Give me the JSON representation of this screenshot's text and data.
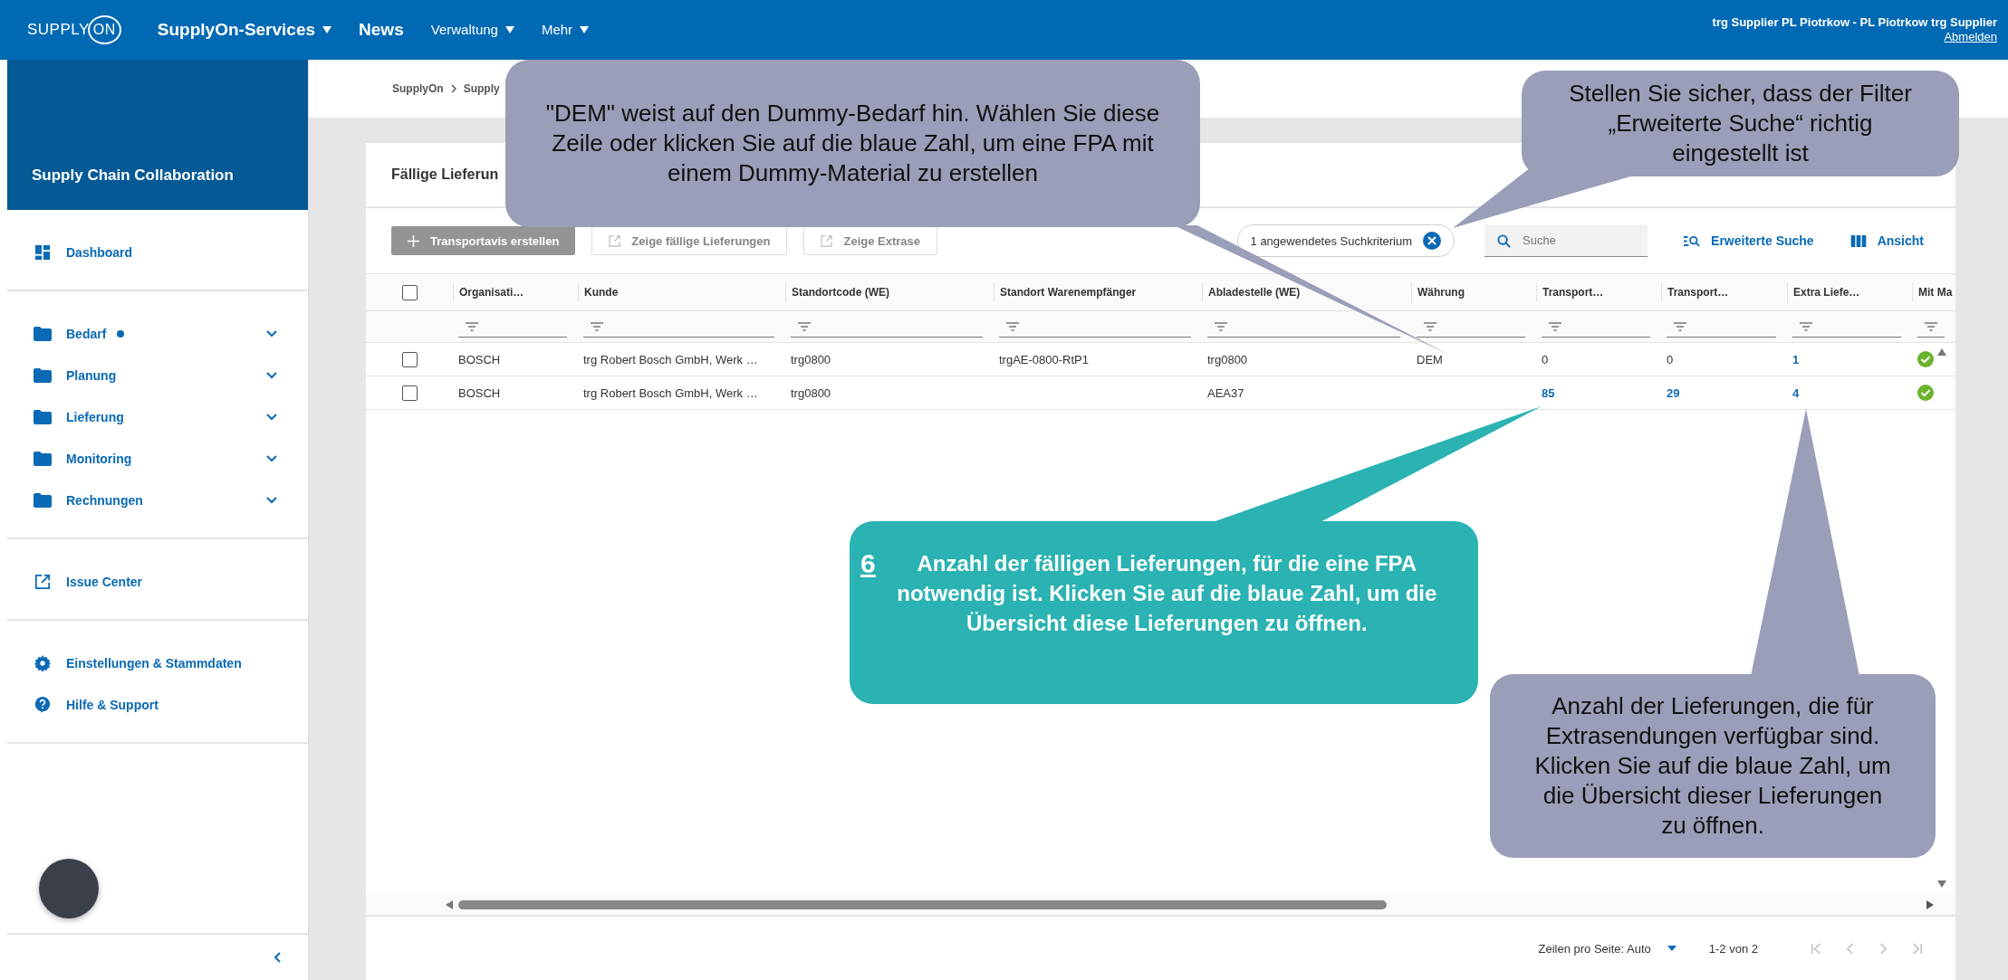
{
  "top_bar": {
    "logo_text": "SUPPLY",
    "logo_mark": "ON",
    "menu": [
      {
        "label": "SupplyOn-Services",
        "kind": "main",
        "dropdown": true
      },
      {
        "label": "News",
        "kind": "main",
        "dropdown": false
      },
      {
        "label": "Verwaltung",
        "kind": "sub",
        "dropdown": true
      },
      {
        "label": "Mehr",
        "kind": "sub",
        "dropdown": true
      }
    ],
    "user": "trg Supplier PL Piotrkow - PL Piotrkow trg Supplier",
    "logout": "Abmelden"
  },
  "sidebar": {
    "header": "Supply Chain Collaboration",
    "groups": [
      [
        {
          "label": "Dashboard",
          "kind": "dashboard"
        }
      ],
      [
        {
          "label": "Bedarf",
          "kind": "folder",
          "expanded": false,
          "notification": true
        },
        {
          "label": "Planung",
          "kind": "folder",
          "expanded": false,
          "notification": false
        },
        {
          "label": "Lieferung",
          "kind": "folder",
          "expanded": false,
          "notification": false
        },
        {
          "label": "Monitoring",
          "kind": "folder",
          "expanded": false,
          "notification": false
        },
        {
          "label": "Rechnungen",
          "kind": "folder",
          "expanded": false,
          "notification": false
        }
      ],
      [
        {
          "label": "Issue Center",
          "kind": "external"
        }
      ],
      [
        {
          "label": "Einstellungen & Stammdaten",
          "kind": "settings"
        },
        {
          "label": "Hilfe & Support",
          "kind": "help"
        }
      ]
    ]
  },
  "breadcrumb": [
    "SupplyOn",
    "Supply"
  ],
  "card": {
    "title": "Fällige Lieferun",
    "toolbar": {
      "buttons": [
        {
          "label": "Transportavis erstellen",
          "kind": "primary",
          "disabled": true
        },
        {
          "label": "Zeige fällige Lieferungen",
          "kind": "outline",
          "disabled": true
        },
        {
          "label": "Zeige Extrase",
          "kind": "outline",
          "disabled": true
        }
      ],
      "chip": "1 angewendetes Suchkriterium",
      "search": {
        "placeholder": "Suche"
      },
      "actions": [
        {
          "label": "Erweiterte Suche",
          "kind": "search"
        },
        {
          "label": "Ansicht",
          "kind": "columns"
        }
      ]
    },
    "table": {
      "all_selected": false,
      "columns": [
        {
          "label": "Organisati…"
        },
        {
          "label": "Kunde"
        },
        {
          "label": "Standortcode (WE)"
        },
        {
          "label": "Standort Warenempfänger"
        },
        {
          "label": "Abladestelle (WE)"
        },
        {
          "label": "Währung"
        },
        {
          "label": "Transport…"
        },
        {
          "label": "Transport…"
        },
        {
          "label": "Extra Liefe…"
        },
        {
          "label": "Mit Ma"
        }
      ],
      "rows": [
        {
          "selected": false,
          "confirmed": true,
          "cells": [
            {
              "text": "BOSCH",
              "link": false
            },
            {
              "text": "trg Robert Bosch GmbH, Werk …",
              "link": false
            },
            {
              "text": "trg0800",
              "link": false
            },
            {
              "text": "trgAE-0800-RtP1",
              "link": false
            },
            {
              "text": "trg0800",
              "link": false
            },
            {
              "text": "DEM",
              "link": false
            },
            {
              "text": "0",
              "link": false
            },
            {
              "text": "0",
              "link": false
            },
            {
              "text": "1",
              "link": true
            }
          ]
        },
        {
          "selected": false,
          "confirmed": true,
          "cells": [
            {
              "text": "BOSCH",
              "link": false
            },
            {
              "text": "trg Robert Bosch GmbH, Werk …",
              "link": false
            },
            {
              "text": "trg0800",
              "link": false
            },
            {},
            {
              "text": "AEA37",
              "link": false
            },
            {},
            {
              "text": "85",
              "link": true
            },
            {
              "text": "29",
              "link": true
            },
            {
              "text": "4",
              "link": true
            }
          ]
        }
      ]
    },
    "pager": {
      "rows_per_page": "Zeilen pro Seite: Auto",
      "range": "1-2 von 2"
    }
  },
  "callouts": [
    {
      "kind": "grey",
      "text": "\"DEM\" weist auf den Dummy-Bedarf hin. Wählen Sie diese Zeile oder klicken Sie auf die blaue Zahl, um eine FPA mit einem Dummy-Material zu erstellen"
    },
    {
      "kind": "grey",
      "text": "Stellen Sie sicher, dass der Filter „Erweiterte Suche“ richtig eingestellt ist"
    },
    {
      "kind": "teal",
      "number": "6",
      "text": "Anzahl der fälligen Lieferungen, für die eine FPA notwendig ist. Klicken Sie auf die blaue Zahl, um die Übersicht diese Lieferungen zu öffnen."
    },
    {
      "kind": "grey",
      "text": "Anzahl der Lieferungen, die für Extrasendungen verfügbar sind. Klicken Sie auf die blaue Zahl, um die Übersicht dieser Lieferungen zu öffnen."
    }
  ]
}
